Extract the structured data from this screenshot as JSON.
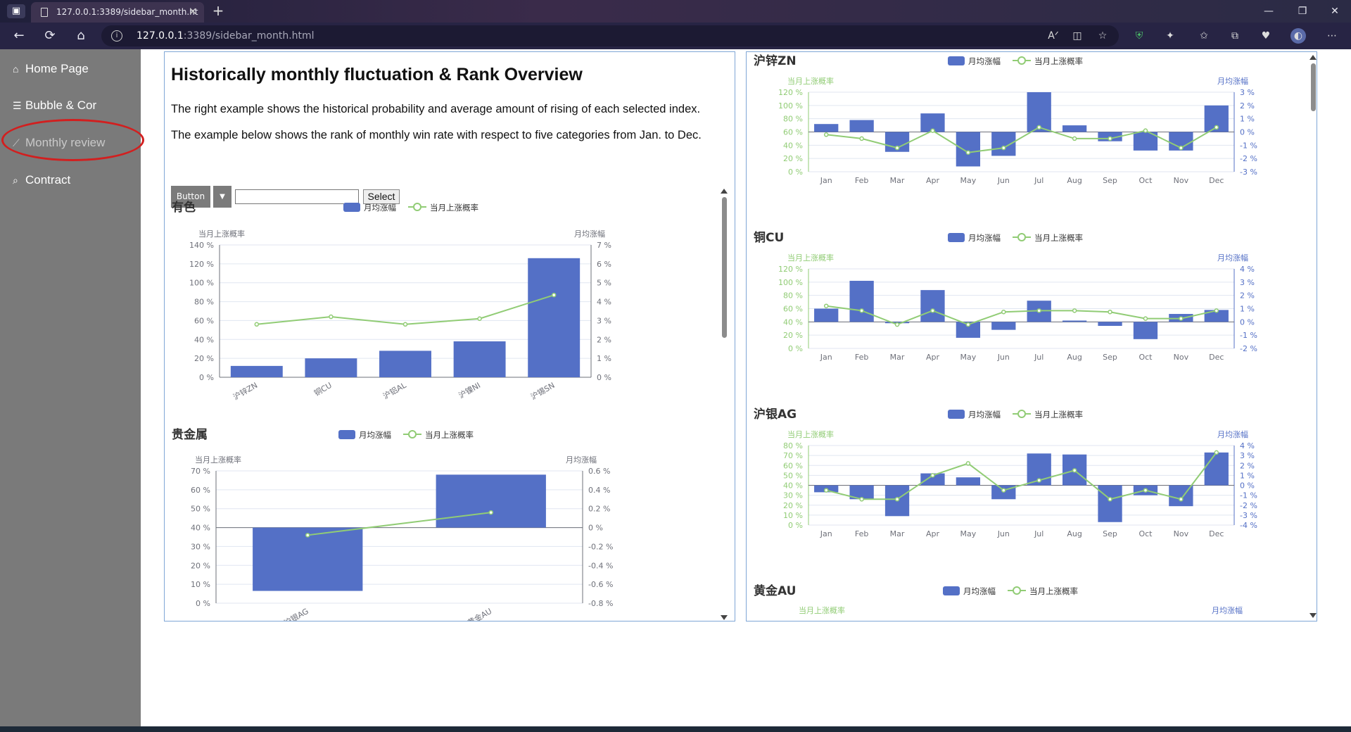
{
  "browser": {
    "tab_title": "127.0.0.1:3389/sidebar_month.ht",
    "url_host": "127.0.0.1",
    "url_path": ":3389/sidebar_month.html"
  },
  "sidebar": {
    "items": [
      {
        "label": "Home Page",
        "icon": "home-icon"
      },
      {
        "label": "Bubble & Cor",
        "icon": "list-icon"
      },
      {
        "label": "Monthly review",
        "icon": "line-chart-icon"
      },
      {
        "label": "Contract",
        "icon": "search-icon"
      }
    ]
  },
  "main": {
    "title": "Historically monthly fluctuation & Rank Overview",
    "desc1": "The right example shows the historical probability and average amount of rising of each selected index.",
    "desc2": "The example below shows the rank of monthly win rate with respect to five categories from Jan. to Dec.",
    "button_label": "Button",
    "select_label": "Select",
    "input_value": ""
  },
  "legend": {
    "bar": "月均涨幅",
    "line": "当月上涨概率"
  },
  "axis_names": {
    "rate": "当月上涨概率",
    "avg": "月均涨幅"
  },
  "colors": {
    "bar": "#5470c6",
    "line": "#91cc75",
    "axis": "#6e7079"
  },
  "chart_data": [
    {
      "type": "bar",
      "title": "有色",
      "categories": [
        "沪锌ZN",
        "铜CU",
        "沪铝AL",
        "沪镍NI",
        "沪锡SN"
      ],
      "series": [
        {
          "name": "月均涨幅",
          "type": "bar",
          "axis": "right",
          "values": [
            0.6,
            1.0,
            1.4,
            1.9,
            6.3
          ]
        },
        {
          "name": "当月上涨概率",
          "type": "line",
          "axis": "left",
          "values": [
            56,
            64,
            56,
            62,
            87
          ]
        }
      ],
      "left_axis": {
        "name": "当月上涨概率",
        "ticks": [
          "0 %",
          "20 %",
          "40 %",
          "60 %",
          "80 %",
          "100 %",
          "120 %",
          "140 %"
        ],
        "ylim": [
          0,
          140
        ]
      },
      "right_axis": {
        "name": "月均涨幅",
        "ticks": [
          "0 %",
          "1 %",
          "2 %",
          "3 %",
          "4 %",
          "5 %",
          "6 %",
          "7 %"
        ],
        "ylim": [
          0,
          7
        ]
      },
      "xlabel": "",
      "grid": true,
      "legend_position": "top-center"
    },
    {
      "type": "bar",
      "title": "贵金属",
      "categories": [
        "沪银AG",
        "黄金AU"
      ],
      "series": [
        {
          "name": "月均涨幅",
          "type": "bar",
          "axis": "right",
          "values": [
            -0.67,
            0.56
          ]
        },
        {
          "name": "当月上涨概率",
          "type": "line",
          "axis": "left",
          "values": [
            36,
            48
          ]
        }
      ],
      "left_axis": {
        "name": "当月上涨概率",
        "ticks": [
          "0 %",
          "10 %",
          "20 %",
          "30 %",
          "40 %",
          "50 %",
          "60 %",
          "70 %"
        ],
        "ylim": [
          0,
          70
        ]
      },
      "right_axis": {
        "name": "月均涨幅",
        "ticks": [
          "-0.8 %",
          "-0.6 %",
          "-0.4 %",
          "-0.2 %",
          "0 %",
          "0.2 %",
          "0.4 %",
          "0.6 %"
        ],
        "ylim": [
          -0.8,
          0.6
        ]
      },
      "xlabel": "",
      "grid": true,
      "legend_position": "top-center"
    },
    {
      "type": "bar",
      "title": "沪锌ZN",
      "categories": [
        "Jan",
        "Feb",
        "Mar",
        "Apr",
        "May",
        "Jun",
        "Jul",
        "Aug",
        "Sep",
        "Oct",
        "Nov",
        "Dec"
      ],
      "series": [
        {
          "name": "月均涨幅",
          "type": "bar",
          "axis": "right",
          "values": [
            0.6,
            0.9,
            -1.5,
            1.4,
            -2.6,
            -1.8,
            3.0,
            0.5,
            -0.7,
            -1.4,
            -1.4,
            2.0
          ]
        },
        {
          "name": "当月上涨概率",
          "type": "line",
          "axis": "left",
          "values": [
            56,
            50,
            36,
            62,
            29,
            36,
            67,
            50,
            50,
            62,
            36,
            67
          ]
        }
      ],
      "left_axis": {
        "name": "当月上涨概率",
        "ticks": [
          "0 %",
          "20 %",
          "40 %",
          "60 %",
          "80 %",
          "100 %",
          "120 %"
        ],
        "ylim": [
          0,
          120
        ]
      },
      "right_axis": {
        "name": "月均涨幅",
        "ticks": [
          "-3 %",
          "-2 %",
          "-1 %",
          "0 %",
          "1 %",
          "2 %",
          "3 %"
        ],
        "ylim": [
          -3,
          3
        ]
      },
      "xlabel": "",
      "grid": true,
      "legend_position": "top-center"
    },
    {
      "type": "bar",
      "title": "铜CU",
      "categories": [
        "Jan",
        "Feb",
        "Mar",
        "Apr",
        "May",
        "Jun",
        "Jul",
        "Aug",
        "Sep",
        "Oct",
        "Nov",
        "Dec"
      ],
      "series": [
        {
          "name": "月均涨幅",
          "type": "bar",
          "axis": "right",
          "values": [
            1.0,
            3.1,
            -0.1,
            2.4,
            -1.2,
            -0.6,
            1.6,
            0.1,
            -0.3,
            -1.3,
            0.6,
            0.9
          ]
        },
        {
          "name": "当月上涨概率",
          "type": "line",
          "axis": "left",
          "values": [
            64,
            57,
            36,
            57,
            36,
            55,
            57,
            57,
            55,
            45,
            45,
            57
          ]
        }
      ],
      "left_axis": {
        "name": "当月上涨概率",
        "ticks": [
          "0 %",
          "20 %",
          "40 %",
          "60 %",
          "80 %",
          "100 %",
          "120 %"
        ],
        "ylim": [
          0,
          120
        ]
      },
      "right_axis": {
        "name": "月均涨幅",
        "ticks": [
          "-2 %",
          "-1 %",
          "0 %",
          "1 %",
          "2 %",
          "3 %",
          "4 %"
        ],
        "ylim": [
          -2,
          4
        ]
      },
      "xlabel": "",
      "grid": true,
      "legend_position": "top-center"
    },
    {
      "type": "bar",
      "title": "沪银AG",
      "categories": [
        "Jan",
        "Feb",
        "Mar",
        "Apr",
        "May",
        "Jun",
        "Jul",
        "Aug",
        "Sep",
        "Oct",
        "Nov",
        "Dec"
      ],
      "series": [
        {
          "name": "月均涨幅",
          "type": "bar",
          "axis": "right",
          "values": [
            -0.7,
            -1.4,
            -3.1,
            1.2,
            0.8,
            -1.4,
            3.2,
            3.1,
            -3.7,
            -1.0,
            -2.1,
            3.3
          ]
        },
        {
          "name": "当月上涨概率",
          "type": "line",
          "axis": "left",
          "values": [
            35,
            26,
            26,
            50,
            62,
            35,
            45,
            55,
            26,
            35,
            26,
            73
          ]
        }
      ],
      "left_axis": {
        "name": "当月上涨概率",
        "ticks": [
          "0 %",
          "10 %",
          "20 %",
          "30 %",
          "40 %",
          "50 %",
          "60 %",
          "70 %",
          "80 %"
        ],
        "ylim": [
          0,
          80
        ]
      },
      "right_axis": {
        "name": "月均涨幅",
        "ticks": [
          "-4 %",
          "-3 %",
          "-2 %",
          "-1 %",
          "0 %",
          "1 %",
          "2 %",
          "3 %",
          "4 %"
        ],
        "ylim": [
          -4,
          4
        ]
      },
      "xlabel": "",
      "grid": true,
      "legend_position": "top-center"
    },
    {
      "type": "bar",
      "title": "黄金AU",
      "categories": [],
      "series": [],
      "left_axis": {
        "name": "当月上涨概率"
      },
      "right_axis": {
        "name": "月均涨幅"
      },
      "xlabel": "",
      "legend_position": "top-center"
    }
  ]
}
